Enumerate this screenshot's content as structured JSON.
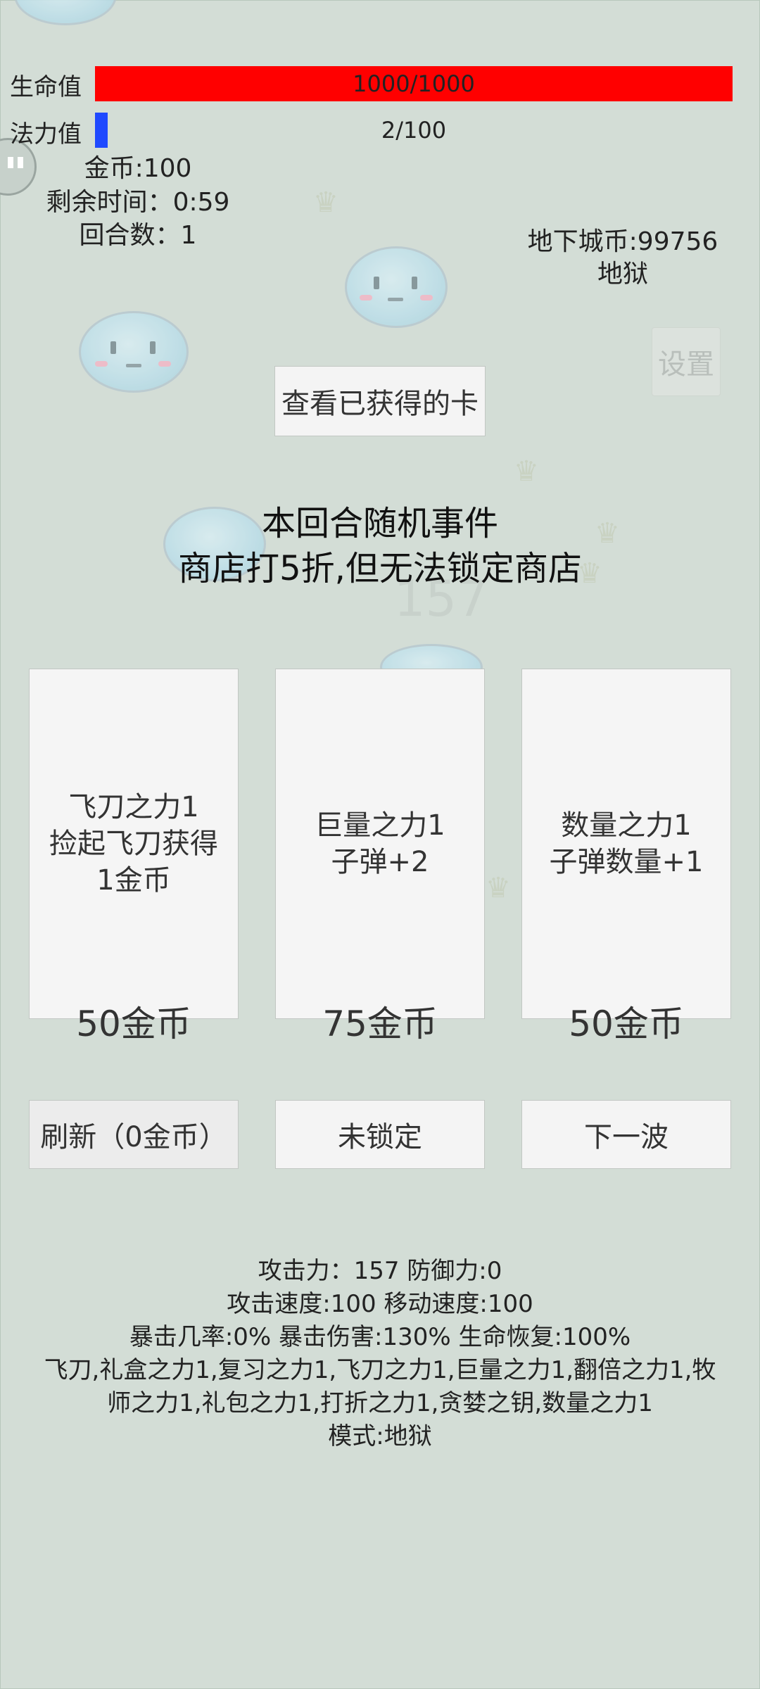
{
  "status": {
    "hp_label": "生命值",
    "hp_text": "1000/1000",
    "hp_current": 1000,
    "hp_max": 1000,
    "mp_label": "法力值",
    "mp_text": "2/100",
    "mp_current": 2,
    "mp_max": 100,
    "gold": "金币:100",
    "time_left": "剩余时间：0:59",
    "round": "回合数：1",
    "dungeon_coins": "地下城币:99756",
    "difficulty": "地狱",
    "colors": {
      "hp": "#ff0000",
      "mp": "#1f49ff"
    }
  },
  "buttons": {
    "settings": "设置",
    "view_cards": "查看已获得的卡",
    "refresh": "刷新（0金币）",
    "lock": "未锁定",
    "next_wave": "下一波"
  },
  "event": {
    "title": "本回合随机事件",
    "description": "商店打5折,但无法锁定商店"
  },
  "shop": {
    "cards": [
      {
        "line1": "飞刀之力1",
        "line2": "捡起飞刀获得",
        "line3": "1金币",
        "price": "50金币"
      },
      {
        "line1": "巨量之力1",
        "line2": "子弹+2",
        "line3": "",
        "price": "75金币"
      },
      {
        "line1": "数量之力1",
        "line2": "子弹数量+1",
        "line3": "",
        "price": "50金币"
      }
    ]
  },
  "player_stats": {
    "line1": "攻击力：157 防御力:0",
    "line2": "攻击速度:100 移动速度:100",
    "line3": "暴击几率:0% 暴击伤害:130% 生命恢复:100%",
    "line4": "飞刀,礼盒之力1,复习之力1,飞刀之力1,巨量之力1,翻倍之力1,牧",
    "line5": "师之力1,礼包之力1,打折之力1,贪婪之钥,数量之力1",
    "line6": "模式:地狱"
  },
  "background": {
    "ghost_number": "157"
  }
}
